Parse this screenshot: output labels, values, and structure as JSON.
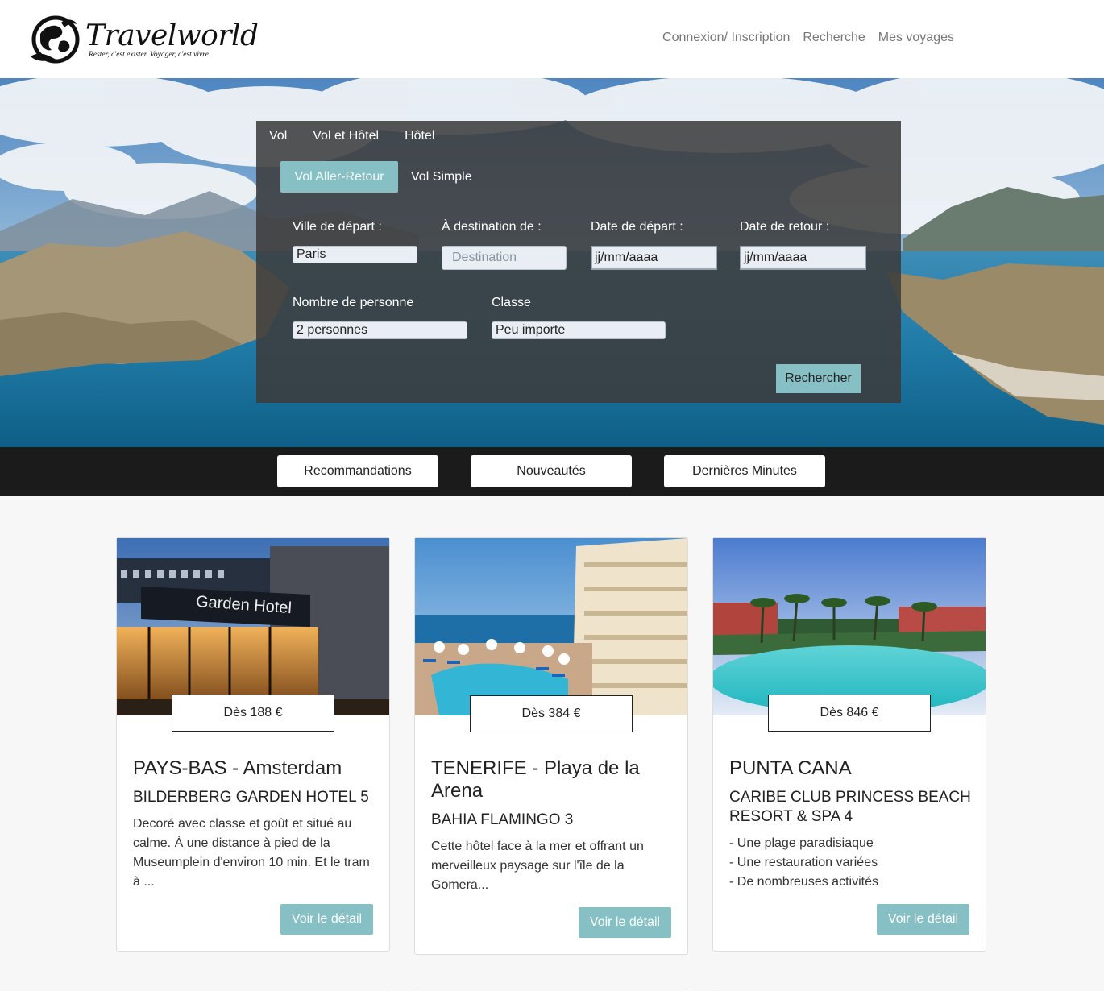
{
  "brand": {
    "name": "Travelworld",
    "tagline": "Rester, c'est exister. Voyager, c'est vivre"
  },
  "nav": {
    "login": "Connexion/ Inscription",
    "search": "Recherche",
    "trips": "Mes voyages"
  },
  "search": {
    "tabs": [
      "Vol",
      "Vol et Hôtel",
      "Hôtel"
    ],
    "subtabs": {
      "active": "Vol Aller-Retour",
      "other": "Vol Simple"
    },
    "departure_label": "Ville de départ :",
    "departure_value": "Paris",
    "destination_label": "À destination de :",
    "destination_placeholder": "Destination",
    "depart_date_label": "Date de départ :",
    "depart_date_value": "jj/mm/aaaa",
    "return_date_label": "Date de retour :",
    "return_date_value": "jj/mm/aaaa",
    "persons_label": "Nombre de personne",
    "persons_value": "2 personnes",
    "class_label": "Classe",
    "class_value": "Peu importe",
    "submit_label": "Rechercher"
  },
  "filters": [
    "Recommandations",
    "Nouveautés",
    "Dernières Minutes"
  ],
  "cards": [
    {
      "price": "Dès 188 €",
      "destination": "PAYS-BAS - Amsterdam",
      "hotel": "BILDERBERG GARDEN HOTEL 5",
      "description": "Decoré avec classe et goût et situé au calme. À une distance à pied de la Museumplein d'environ 10 min. Et le tram à ...",
      "sign_text": "Garden Hotel",
      "button": "Voir le détail"
    },
    {
      "price": "Dès 384 €",
      "destination": "TENERIFE - Playa de la Arena",
      "hotel": "BAHIA FLAMINGO 3",
      "description": "Cette hôtel face à la mer et offrant un merveilleux paysage sur l'île de la Gomera...",
      "button": "Voir le détail"
    },
    {
      "price": "Dès 846 €",
      "destination": "PUNTA CANA",
      "hotel": "CARIBE CLUB PRINCESS BEACH RESORT & SPA 4",
      "bullets": [
        "- Une plage paradisiaque",
        "- Une restauration variées",
        "- De nombreuses activités"
      ],
      "button": "Voir le détail"
    }
  ],
  "colors": {
    "accent": "#86bfc4",
    "panel": "#3c3c3c",
    "filterbar": "#1b1b1b",
    "sea": "#2f86b0"
  },
  "icons": {
    "logo": "globe-with-bird-icon"
  }
}
